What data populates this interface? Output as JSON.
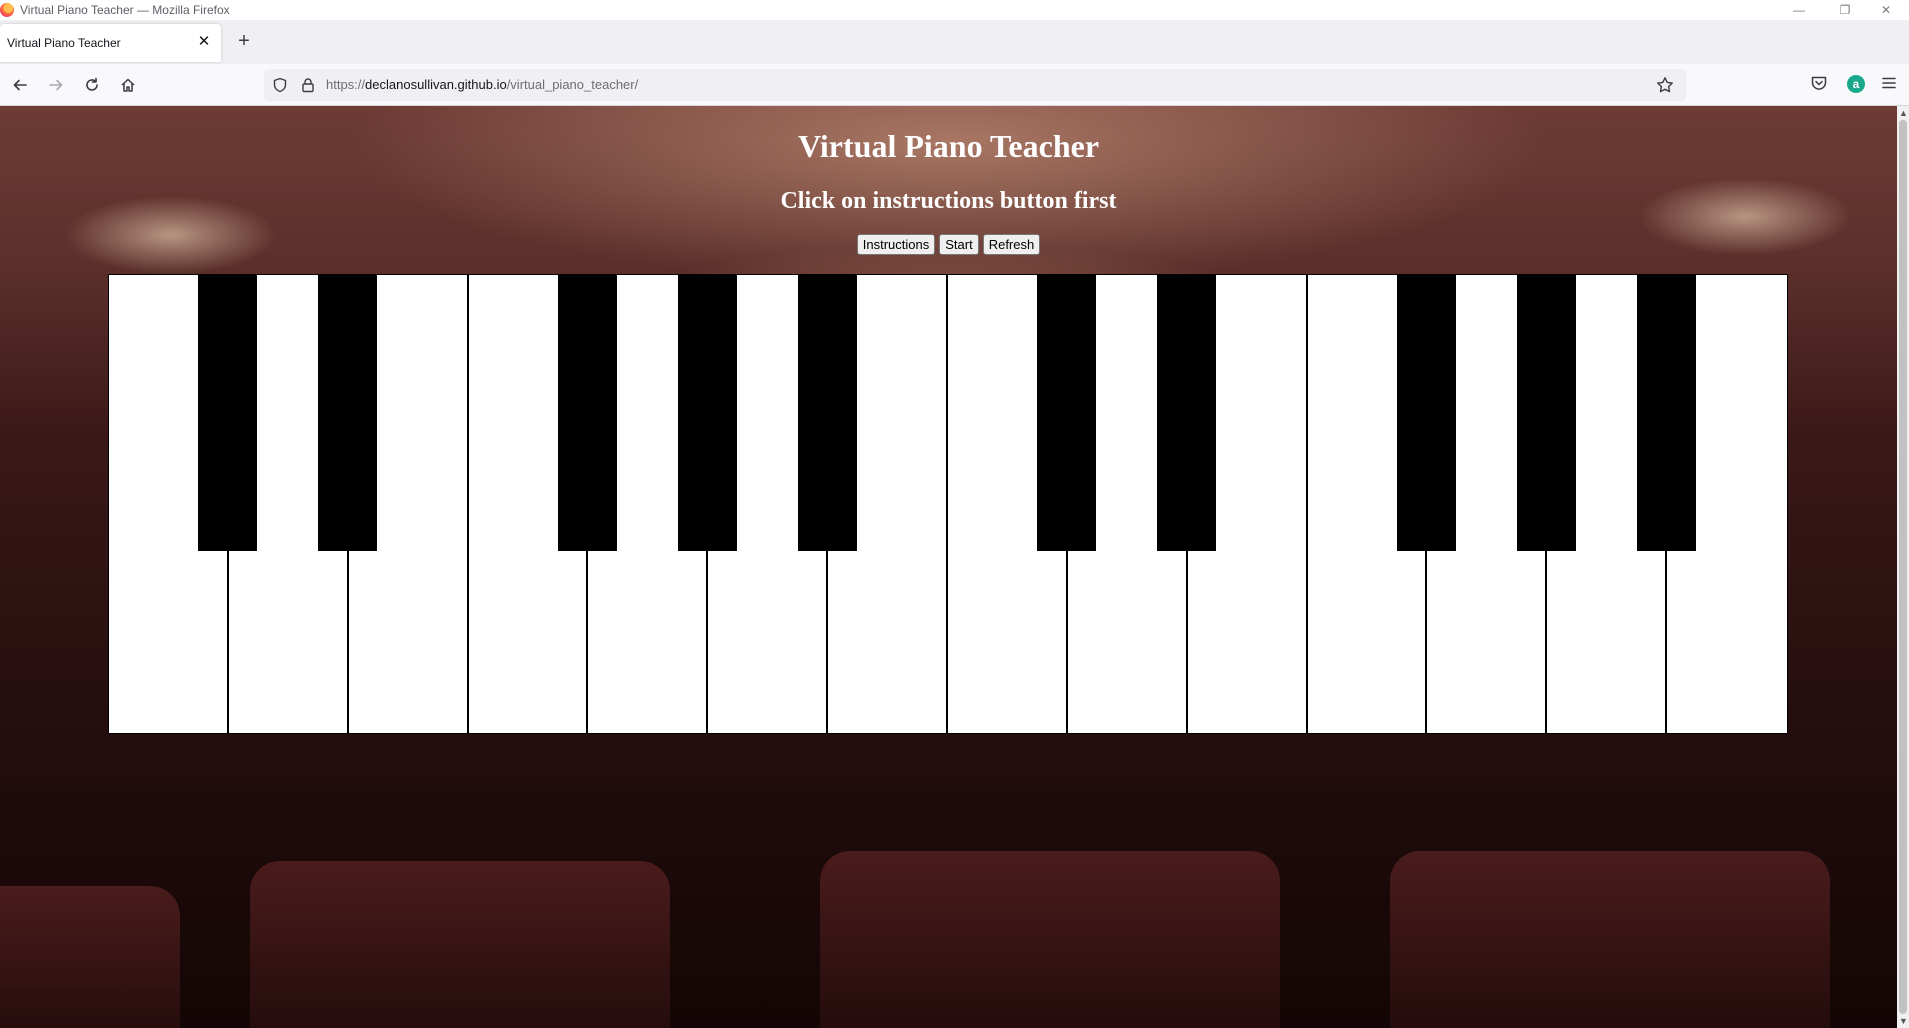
{
  "window": {
    "title": "Virtual Piano Teacher — Mozilla Firefox",
    "minimize": "—",
    "restore": "❐",
    "close": "✕"
  },
  "tabs": [
    {
      "label": "Virtual Piano Teacher",
      "active": true
    }
  ],
  "tab_close": "✕",
  "new_tab": "+",
  "address": {
    "scheme": "https://",
    "host": "declanosullivan.github.io",
    "path": "/virtual_piano_teacher/"
  },
  "account_initial": "a",
  "page": {
    "title": "Virtual Piano Teacher",
    "subtitle": "Click on instructions button first",
    "buttons": {
      "instructions": "Instructions",
      "start": "Start",
      "refresh": "Refresh"
    }
  },
  "piano": {
    "white_keys": 14,
    "black_keys_after_white_index": [
      0,
      1,
      3,
      4,
      5,
      7,
      8,
      10,
      11,
      12
    ],
    "colors": {
      "white": "#ffffff",
      "black": "#000000"
    }
  },
  "icons": [
    "firefox-icon",
    "back-icon",
    "forward-icon",
    "reload-icon",
    "home-icon",
    "shield-icon",
    "lock-icon",
    "bookmark-star-icon",
    "pocket-icon",
    "account-icon",
    "menu-icon"
  ]
}
